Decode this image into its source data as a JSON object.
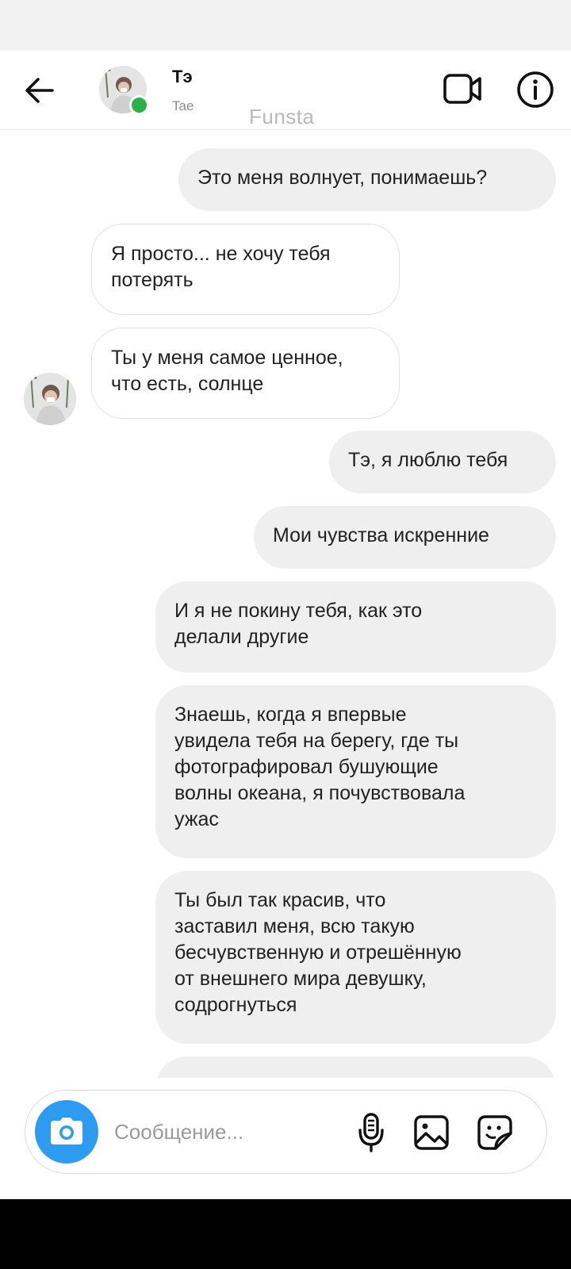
{
  "header": {
    "contact_name": "Тэ",
    "contact_username": "Tae",
    "back_icon": "arrow-left-icon",
    "video_icon": "video-camera-icon",
    "info_icon": "info-icon"
  },
  "watermark": "Funsta",
  "messages": [
    {
      "direction": "outgoing",
      "text": "Это меня волнует, понимаешь?"
    },
    {
      "direction": "incoming",
      "text": "Я просто... не хочу тебя\nпотерять"
    },
    {
      "direction": "incoming",
      "text": "Ты у меня самое ценное,\nчто есть, солнце"
    },
    {
      "direction": "outgoing",
      "text": "Тэ, я люблю тебя"
    },
    {
      "direction": "outgoing",
      "text": "Мои чувства искренние"
    },
    {
      "direction": "outgoing",
      "text": "И я не покину тебя, как это\nделали другие"
    },
    {
      "direction": "outgoing",
      "text": "Знаешь, когда я впервые\nувидела тебя на берегу, где ты\nфотографировал бушующие\nволны океана, я почувствовала\nужас"
    },
    {
      "direction": "outgoing",
      "text": "Ты был так красив, что\nзаставил меня, всю такую\nбесчувственную и отрешённую\nот внешнего мира девушку,\nсодрогнуться"
    }
  ],
  "composer": {
    "placeholder": "Сообщение...",
    "camera_icon": "camera-icon",
    "mic_icon": "microphone-icon",
    "gallery_icon": "image-icon",
    "sticker_icon": "sticker-icon"
  },
  "colors": {
    "outgoing_bubble": "#efefef",
    "incoming_bubble_border": "#e2e2e2",
    "online_dot": "#2ab24a",
    "camera_button": "#2d9cf0"
  }
}
